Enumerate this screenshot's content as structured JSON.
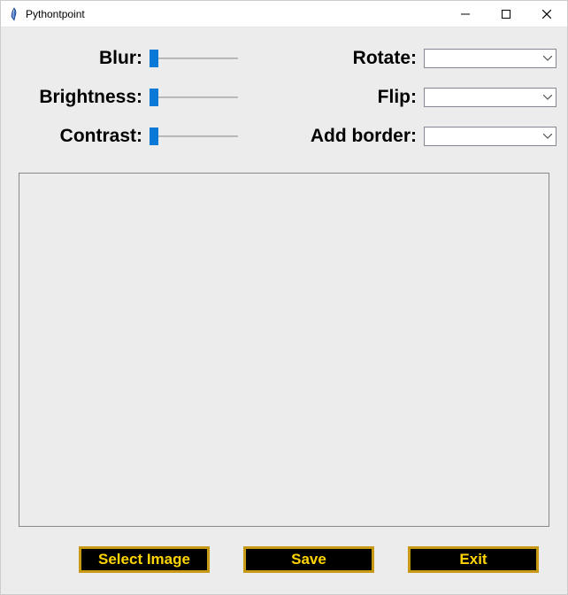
{
  "window": {
    "title": "Pythontpoint"
  },
  "labels": {
    "blur": "Blur:",
    "brightness": "Brightness:",
    "contrast": "Contrast:",
    "rotate": "Rotate:",
    "flip": "Flip:",
    "add_border": "Add border:"
  },
  "combos": {
    "rotate_value": "",
    "flip_value": "",
    "add_border_value": ""
  },
  "buttons": {
    "select_image": "Select Image",
    "save": "Save",
    "exit": "Exit"
  }
}
